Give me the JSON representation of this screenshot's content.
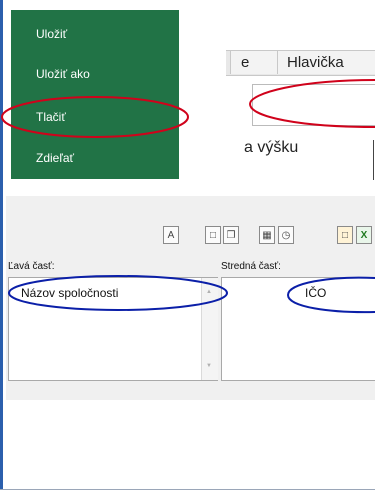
{
  "file_menu": {
    "items": [
      "Uložiť",
      "Uložiť ako",
      "Tlačiť",
      "Zdieľať"
    ]
  },
  "ribbon": {
    "tab_partial": "e",
    "tab_header": "Hlavička",
    "heading_partial": "a výšku"
  },
  "toolbar": {
    "format_text_button": "A",
    "insert_picture_label_partial": "X"
  },
  "header_dialog": {
    "left_section_label": "Ľavá časť:",
    "left_section_value": "Názov spoločnosti",
    "middle_section_label": "Stredná časť:",
    "middle_section_value": "IČO"
  },
  "annotations": {
    "color": "#d0021b",
    "color2": "#0b1fa8"
  }
}
